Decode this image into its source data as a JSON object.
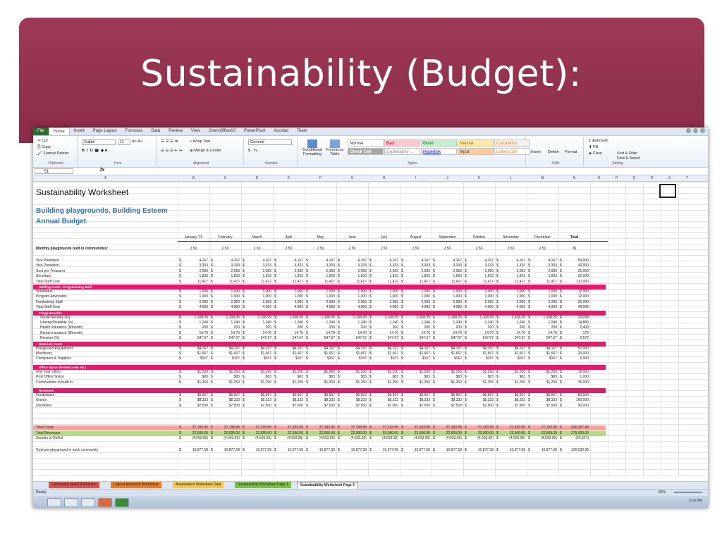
{
  "slide": {
    "title": "Sustainability (Budget):"
  },
  "ribbon": {
    "tabs": [
      "File",
      "Home",
      "Insert",
      "Page Layout",
      "Formulas",
      "Data",
      "Review",
      "View",
      "ChemOffice13",
      "PowerPivot",
      "Acrobat",
      "Team"
    ],
    "clipboard": {
      "cut": "Cut",
      "copy": "Copy",
      "format_painter": "Format Painter",
      "label": "Clipboard"
    },
    "font": {
      "name": "Calibri",
      "size": "11",
      "label": "Font"
    },
    "alignment": {
      "wrap": "Wrap Text",
      "merge": "Merge & Center",
      "label": "Alignment"
    },
    "number": {
      "format": "General",
      "label": "Number",
      "symbols": "$ - % ,"
    },
    "styles": {
      "conditional": "Conditional Formatting",
      "format_table": "Format as Table",
      "label": "Styles",
      "cells": [
        "Normal",
        "Bad",
        "Good",
        "Neutral",
        "Calculation",
        "Check Cell",
        "Explanatory ...",
        "Hyperlink",
        "Input",
        "Linked Cell"
      ]
    },
    "cells": {
      "insert": "Insert",
      "delete": "Delete",
      "format": "Format",
      "label": "Cells"
    },
    "editing": {
      "autosum": "AutoSum",
      "fill": "Fill",
      "clear": "Clear",
      "sort": "Sort & Filter",
      "find": "Find & Select",
      "label": "Editing"
    }
  },
  "formula_bar": {
    "namebox": "S1",
    "fx": "fx"
  },
  "columns": [
    "A",
    "B",
    "C",
    "D",
    "E",
    "F",
    "G",
    "H",
    "I",
    "J",
    "K",
    "L",
    "M",
    "N",
    "O",
    "P",
    "Q",
    "R",
    "S",
    "T"
  ],
  "sheet": {
    "title": "Sustainability Worksheet",
    "subtitle1": "Building playgrounds, Building Esteem",
    "subtitle2": "Annual Budget",
    "months": [
      "January '15",
      "February",
      "March",
      "April",
      "May",
      "June",
      "July",
      "August",
      "September",
      "October",
      "November",
      "December",
      "Total"
    ],
    "playgrounds_label": "Monthly playgrounds built in communities:",
    "playgrounds_values": [
      "2.50",
      "2.50",
      "2.50",
      "2.50",
      "2.50",
      "2.50",
      "2.50",
      "2.50",
      "2.50",
      "2.50",
      "2.50",
      "2.50",
      "30"
    ],
    "sections": [
      {
        "rows": [
          {
            "label": "Vice President",
            "v": "4,167",
            "t": "50,000"
          },
          {
            "label": "Vice President",
            "v": "3,333",
            "t": "40,000"
          },
          {
            "label": "Sect per Treasurer",
            "v": "2,083",
            "t": "25,000"
          },
          {
            "label": "Secretary",
            "v": "1,833",
            "t": "22,000"
          },
          {
            "label": "Total Staff Cost",
            "v": "11,417",
            "t": "137,000"
          }
        ]
      },
      {
        "header": "Staffing Costs - Programming Staff",
        "rows": [
          {
            "label": "Volunteers",
            "v": "1,000",
            "t": "12,000"
          },
          {
            "label": "Program Advocates",
            "v": "1,000",
            "t": "12,000"
          },
          {
            "label": "Fundraising Staff",
            "v": "2,083",
            "t": "25,000"
          },
          {
            "label": "Total Staff Cost",
            "v": "4,083",
            "t": "49,000"
          }
        ]
      },
      {
        "header": "Fringe Benefits",
        "rows": [
          {
            "label": "Social Security (%)",
            "v": "1,108.25",
            "t": "13,299"
          },
          {
            "label": "Unemp/Disability (%)",
            "v": "1,240",
            "t": "14,880"
          },
          {
            "label": "Health insurance ($/month)",
            "v": "200",
            "t": "2,400"
          },
          {
            "label": "Dental insurance ($/month)",
            "v": "14.70",
            "t": "176"
          },
          {
            "label": "Pension (%)",
            "v": "547.67",
            "t": "6,572"
          }
        ]
      },
      {
        "header": "Materials Costs",
        "rows": [
          {
            "label": "Playground Equiptment",
            "v": "$4,167",
            "t": "50,000"
          },
          {
            "label": "Machinery",
            "v": "$1,667",
            "t": "20,000"
          },
          {
            "label": "Computers & Supplies",
            "v": "$167",
            "t": "2,000"
          }
        ]
      },
      {
        "header": "Office Space (Rental costs etc.)",
        "rows": [
          {
            "label": "One main office",
            "v": "$1,250",
            "t": "15,000"
          },
          {
            "label": "Post Office Space",
            "v": "$83",
            "t": "1,000"
          },
          {
            "label": "Communities to build in",
            "v": "$1,250",
            "t": "15,000"
          }
        ]
      },
      {
        "header": "Revenues",
        "rows": [
          {
            "label": "Fundraisers",
            "v": "$6,667",
            "t": "80,000"
          },
          {
            "label": "Grants",
            "v": "$8,333",
            "t": "100,000"
          },
          {
            "label": "Donations",
            "v": "$7,500",
            "t": "90,000"
          }
        ]
      }
    ],
    "totals": [
      {
        "label": "Total Costs",
        "v": "27,193.95",
        "t": "326,327.40",
        "color": "#f4a3a3"
      },
      {
        "label": "Total Revenues",
        "v": "22,500.00",
        "t": "270,000.00",
        "color": "#b5d98a"
      },
      {
        "label": "Surplus or Deficit",
        "v": "(4,693.95)",
        "t": "(56,327)",
        "color": "#ffffff"
      }
    ],
    "cost_per": {
      "label": "Cost per playground in each community",
      "v": "10,877.58",
      "t": "130,530.96"
    }
  },
  "sheet_tabs": [
    {
      "label": "Community Need Worksheet",
      "color": "#d9534f"
    },
    {
      "label": "Logical Approach Worksheet",
      "color": "#e87c2a"
    },
    {
      "label": "Assessment Worksheet Data",
      "color": "#f2c94c"
    },
    {
      "label": "Sustainability Worksheet Page 1",
      "color": "#7cc04b"
    },
    {
      "label": "Sustainability Worksheet Page 2",
      "color": "#ffffff"
    }
  ],
  "status": {
    "ready": "Ready",
    "zoom": "82%",
    "time": "5:10 PM"
  }
}
